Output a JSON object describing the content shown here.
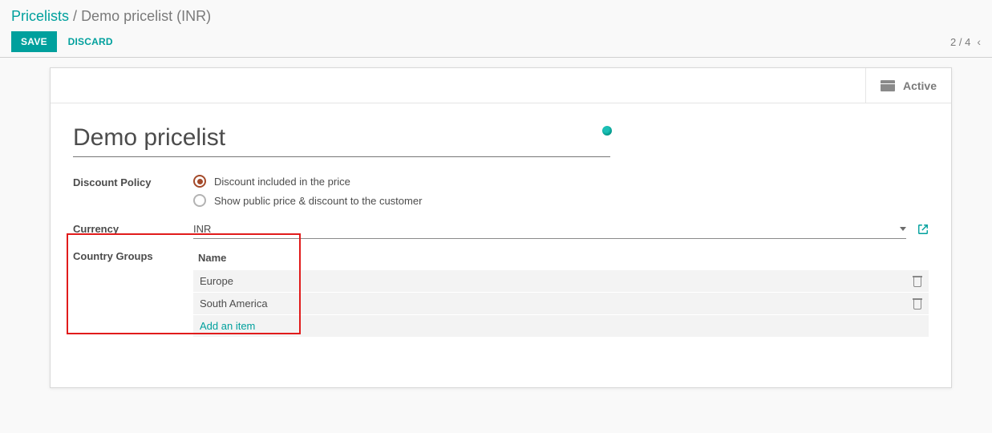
{
  "breadcrumb": {
    "root": "Pricelists",
    "separator": "/",
    "current": "Demo pricelist (INR)"
  },
  "actions": {
    "save": "SAVE",
    "discard": "DISCARD"
  },
  "pager": {
    "text": "2 / 4"
  },
  "status": {
    "active_label": "Active"
  },
  "form": {
    "title": "Demo pricelist",
    "discount_policy_label": "Discount Policy",
    "discount_option_1": "Discount included in the price",
    "discount_option_2": "Show public price & discount to the customer",
    "currency_label": "Currency",
    "currency_value": "INR",
    "country_groups_label": "Country Groups",
    "cg_header_name": "Name",
    "cg_rows": {
      "0": "Europe",
      "1": "South America"
    },
    "add_item": "Add an item"
  }
}
